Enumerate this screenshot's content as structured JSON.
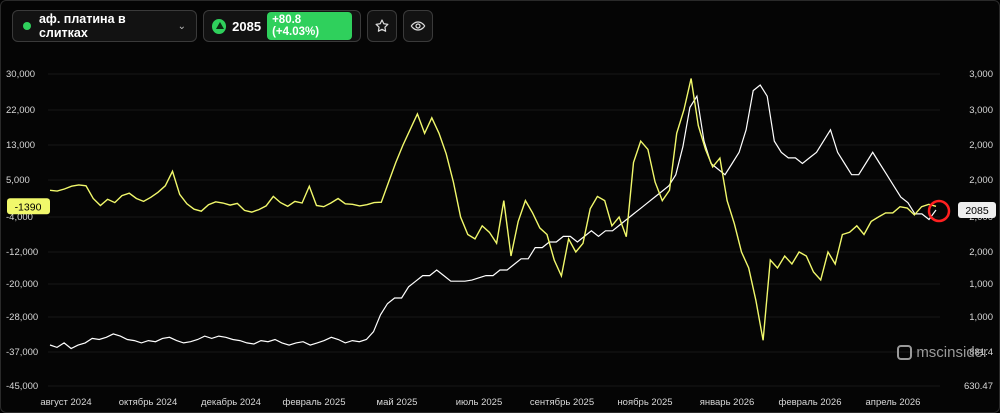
{
  "toolbar": {
    "instrument": "аф. платина в слитках",
    "price": "2085",
    "change": "+80.8 (+4.03%)",
    "star_icon": "star-icon",
    "eye_icon": "eye-icon"
  },
  "watermark": "mscinsider",
  "colors": {
    "position_line": "#f1f86b",
    "price_line": "#ffffff",
    "up": "#2fd05c",
    "marker": "#ff2020"
  },
  "chart_data": {
    "type": "line",
    "x_ticks": [
      "август 2024",
      "октябрь 2024",
      "декабрь 2024",
      "февраль 2025",
      "май 2025",
      "июль 2025",
      "сентябрь 2025",
      "ноябрь 2025",
      "январь 2026",
      "февраль 2026",
      "апрель 2026"
    ],
    "left_axis": {
      "ticks": [
        "30,000",
        "22,000",
        "13,000",
        "5,000",
        "-4,000",
        "-12,000",
        "-20,000",
        "-28,000",
        "-37,000",
        "-45,000"
      ],
      "ylim": [
        -45000,
        30000
      ]
    },
    "right_axis": {
      "ticks": [
        "3,000",
        "3,000",
        "2,000",
        "2,000",
        "2,000",
        "2,000",
        "1,000",
        "1,000",
        "881.4",
        "630.47"
      ]
    },
    "current_labels": {
      "left": "-1390",
      "right": "2085"
    },
    "series": [
      {
        "axis": "left",
        "values": [
          2500,
          2300,
          2800,
          3500,
          3800,
          3600,
          500,
          -1200,
          300,
          -500,
          1200,
          1800,
          500,
          -200,
          800,
          2000,
          3600,
          7000,
          1500,
          -800,
          -2100,
          -2600,
          -1000,
          -300,
          -600,
          -1100,
          -700,
          -2400,
          -2800,
          -2200,
          -1300,
          1000,
          -500,
          -1400,
          -200,
          -600,
          3500,
          -1200,
          -1500,
          -600,
          500,
          -800,
          -900,
          -1300,
          -1000,
          -500,
          -400,
          4500,
          9000,
          13000,
          17000,
          21000,
          16000,
          20000,
          16000,
          11000,
          4500,
          -4000,
          -8000,
          -9000,
          -6000,
          -7500,
          -10000,
          0,
          -13000,
          -5000,
          0,
          -3000,
          -6500,
          -8000,
          -14000,
          -18000,
          -9000,
          -12000,
          -10000,
          -2000,
          1000,
          0,
          -6000,
          -4000,
          -8500,
          9000,
          14000,
          12000,
          4500,
          0,
          2500,
          16000,
          22000,
          29000,
          18000,
          12000,
          8000,
          10000,
          0,
          -5500,
          -12000,
          -16000,
          -24000,
          -34000,
          -14000,
          -16000,
          -13000,
          -15000,
          -12000,
          -13000,
          -17000,
          -19000,
          -12000,
          -15000,
          -8000,
          -7500,
          -6000,
          -8000,
          -5000,
          -4000,
          -3000,
          -3000,
          -1500,
          -1800,
          -3500,
          -1500,
          -900,
          -1390
        ]
      },
      {
        "axis": "right",
        "values": [
          881,
          860,
          900,
          850,
          880,
          900,
          940,
          930,
          950,
          980,
          960,
          930,
          920,
          900,
          920,
          910,
          940,
          950,
          920,
          900,
          910,
          930,
          960,
          940,
          960,
          950,
          930,
          920,
          900,
          890,
          920,
          910,
          930,
          900,
          880,
          900,
          910,
          880,
          900,
          920,
          950,
          930,
          900,
          920,
          910,
          930,
          1000,
          1150,
          1250,
          1300,
          1300,
          1400,
          1450,
          1500,
          1500,
          1550,
          1500,
          1450,
          1450,
          1450,
          1460,
          1480,
          1500,
          1500,
          1550,
          1550,
          1600,
          1650,
          1650,
          1750,
          1750,
          1800,
          1800,
          1850,
          1850,
          1800,
          1850,
          1900,
          1850,
          1900,
          1900,
          1950,
          2000,
          2050,
          2100,
          2150,
          2200,
          2250,
          2300,
          2400,
          2650,
          3000,
          3100,
          2700,
          2500,
          2450,
          2400,
          2500,
          2600,
          2800,
          3150,
          3200,
          3100,
          2700,
          2600,
          2550,
          2550,
          2500,
          2550,
          2600,
          2700,
          2800,
          2600,
          2500,
          2400,
          2400,
          2500,
          2600,
          2500,
          2400,
          2300,
          2200,
          2150,
          2050,
          2050,
          2000,
          2085
        ]
      }
    ]
  }
}
